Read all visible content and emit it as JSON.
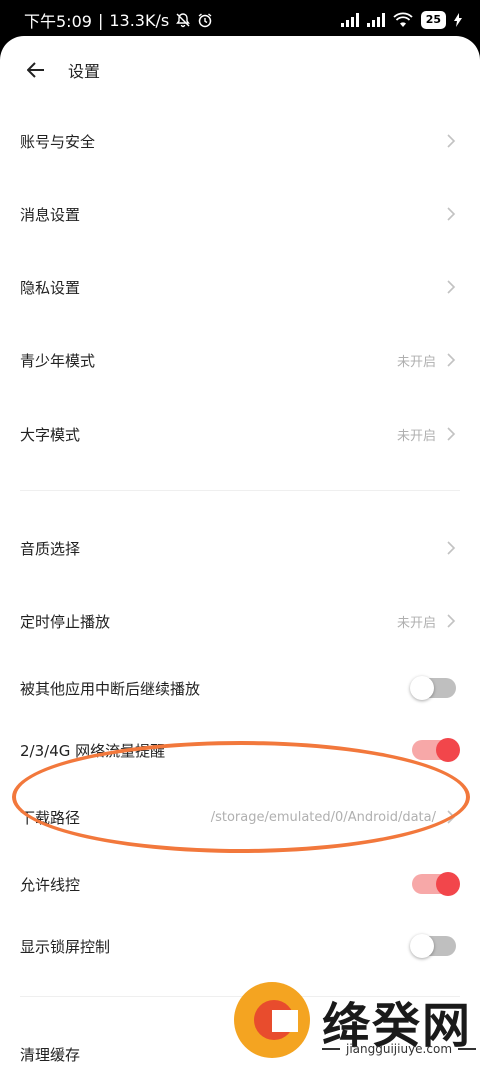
{
  "status_bar": {
    "time": "下午5:09",
    "speed": "13.3K/s",
    "battery": "25"
  },
  "header": {
    "title": "设置"
  },
  "group1": [
    {
      "label": "账号与安全",
      "value": ""
    },
    {
      "label": "消息设置",
      "value": ""
    },
    {
      "label": "隐私设置",
      "value": ""
    },
    {
      "label": "青少年模式",
      "value": "未开启"
    },
    {
      "label": "大字模式",
      "value": "未开启"
    }
  ],
  "group2": {
    "audio_quality": {
      "label": "音质选择"
    },
    "sleep_timer": {
      "label": "定时停止播放",
      "value": "未开启"
    },
    "resume_after_interrupt": {
      "label": "被其他应用中断后继续播放",
      "on": false
    },
    "data_alert": {
      "label": "2/3/4G 网络流量提醒",
      "on": true
    },
    "download_path": {
      "label": "下载路径",
      "value": "/storage/emulated/0/Android/data/"
    },
    "wire_control": {
      "label": "允许线控",
      "on": true
    },
    "lockscreen_control": {
      "label": "显示锁屏控制",
      "on": false
    }
  },
  "group3": {
    "clear_cache": {
      "label": "清理缓存"
    }
  },
  "watermark": {
    "name": "绛癸网",
    "domain": "jiangguijiuye.com"
  },
  "colors": {
    "toggle_on": "#f2464b",
    "toggle_on_track": "#f7a8a8",
    "highlight_oval": "#f2783c"
  }
}
